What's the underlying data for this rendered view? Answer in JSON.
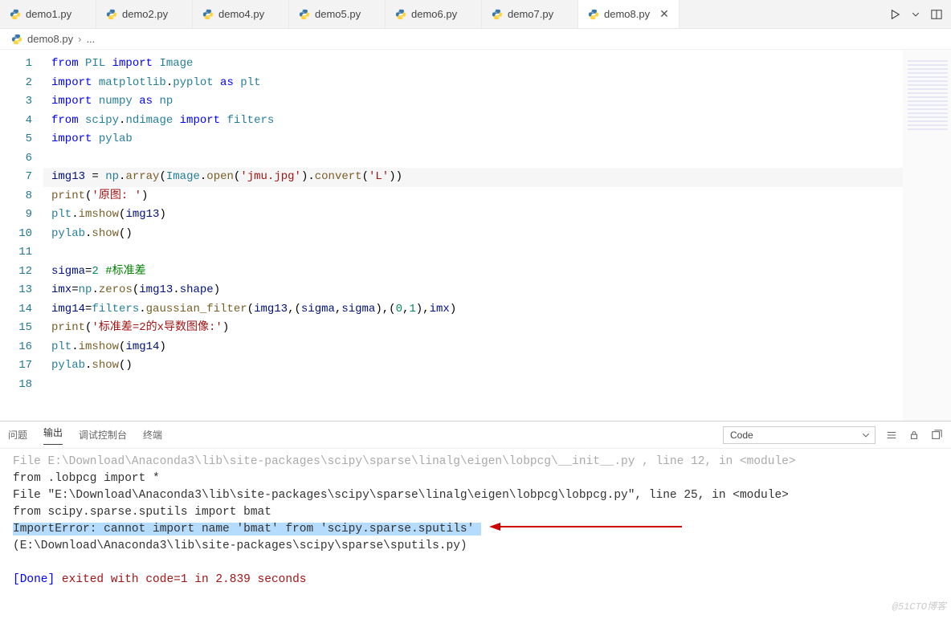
{
  "tabs": [
    {
      "label": "demo1.py"
    },
    {
      "label": "demo2.py"
    },
    {
      "label": "demo4.py"
    },
    {
      "label": "demo5.py"
    },
    {
      "label": "demo6.py"
    },
    {
      "label": "demo7.py"
    },
    {
      "label": "demo8.py",
      "active": true
    }
  ],
  "active_tab_close": "✕",
  "breadcrumb": {
    "file": "demo8.py",
    "sep": "›",
    "rest": "..."
  },
  "code_lines": [
    [
      {
        "t": "from ",
        "c": "kw"
      },
      {
        "t": "PIL ",
        "c": "mod"
      },
      {
        "t": "import ",
        "c": "kw"
      },
      {
        "t": "Image",
        "c": "cls"
      }
    ],
    [
      {
        "t": "import ",
        "c": "kw"
      },
      {
        "t": "matplotlib",
        "c": "mod"
      },
      {
        "t": ".",
        "c": "op"
      },
      {
        "t": "pyplot ",
        "c": "mod"
      },
      {
        "t": "as ",
        "c": "kw"
      },
      {
        "t": "plt",
        "c": "mod"
      }
    ],
    [
      {
        "t": "import ",
        "c": "kw"
      },
      {
        "t": "numpy ",
        "c": "mod"
      },
      {
        "t": "as ",
        "c": "kw"
      },
      {
        "t": "np",
        "c": "mod"
      }
    ],
    [
      {
        "t": "from ",
        "c": "kw"
      },
      {
        "t": "scipy",
        "c": "mod"
      },
      {
        "t": ".",
        "c": "op"
      },
      {
        "t": "ndimage ",
        "c": "mod"
      },
      {
        "t": "import ",
        "c": "kw"
      },
      {
        "t": "filters",
        "c": "mod"
      }
    ],
    [
      {
        "t": "import ",
        "c": "kw"
      },
      {
        "t": "pylab",
        "c": "mod"
      }
    ],
    [],
    [
      {
        "t": "img13 ",
        "c": "var"
      },
      {
        "t": "= ",
        "c": "op"
      },
      {
        "t": "np",
        "c": "mod"
      },
      {
        "t": ".",
        "c": "op"
      },
      {
        "t": "array",
        "c": "fn"
      },
      {
        "t": "(",
        "c": "op"
      },
      {
        "t": "Image",
        "c": "cls"
      },
      {
        "t": ".",
        "c": "op"
      },
      {
        "t": "open",
        "c": "fn"
      },
      {
        "t": "(",
        "c": "op"
      },
      {
        "t": "'jmu.jpg'",
        "c": "str"
      },
      {
        "t": ")",
        "c": "op"
      },
      {
        "t": ".",
        "c": "op"
      },
      {
        "t": "convert",
        "c": "fn"
      },
      {
        "t": "(",
        "c": "op"
      },
      {
        "t": "'L'",
        "c": "str"
      },
      {
        "t": "))",
        "c": "op"
      }
    ],
    [
      {
        "t": "print",
        "c": "fn"
      },
      {
        "t": "(",
        "c": "op"
      },
      {
        "t": "'原图: '",
        "c": "str"
      },
      {
        "t": ")",
        "c": "op"
      }
    ],
    [
      {
        "t": "plt",
        "c": "mod"
      },
      {
        "t": ".",
        "c": "op"
      },
      {
        "t": "imshow",
        "c": "fn"
      },
      {
        "t": "(",
        "c": "op"
      },
      {
        "t": "img13",
        "c": "var"
      },
      {
        "t": ")",
        "c": "op"
      }
    ],
    [
      {
        "t": "pylab",
        "c": "mod"
      },
      {
        "t": ".",
        "c": "op"
      },
      {
        "t": "show",
        "c": "fn"
      },
      {
        "t": "()",
        "c": "op"
      }
    ],
    [],
    [
      {
        "t": "sigma",
        "c": "var"
      },
      {
        "t": "=",
        "c": "op"
      },
      {
        "t": "2 ",
        "c": "num"
      },
      {
        "t": "#标准差",
        "c": "cmt"
      }
    ],
    [
      {
        "t": "imx",
        "c": "var"
      },
      {
        "t": "=",
        "c": "op"
      },
      {
        "t": "np",
        "c": "mod"
      },
      {
        "t": ".",
        "c": "op"
      },
      {
        "t": "zeros",
        "c": "fn"
      },
      {
        "t": "(",
        "c": "op"
      },
      {
        "t": "img13",
        "c": "var"
      },
      {
        "t": ".",
        "c": "op"
      },
      {
        "t": "shape",
        "c": "var"
      },
      {
        "t": ")",
        "c": "op"
      }
    ],
    [
      {
        "t": "img14",
        "c": "var"
      },
      {
        "t": "=",
        "c": "op"
      },
      {
        "t": "filters",
        "c": "mod"
      },
      {
        "t": ".",
        "c": "op"
      },
      {
        "t": "gaussian_filter",
        "c": "fn"
      },
      {
        "t": "(",
        "c": "op"
      },
      {
        "t": "img13",
        "c": "var"
      },
      {
        "t": ",(",
        "c": "op"
      },
      {
        "t": "sigma",
        "c": "var"
      },
      {
        "t": ",",
        "c": "op"
      },
      {
        "t": "sigma",
        "c": "var"
      },
      {
        "t": "),(",
        "c": "op"
      },
      {
        "t": "0",
        "c": "num"
      },
      {
        "t": ",",
        "c": "op"
      },
      {
        "t": "1",
        "c": "num"
      },
      {
        "t": "),",
        "c": "op"
      },
      {
        "t": "imx",
        "c": "var"
      },
      {
        "t": ")",
        "c": "op"
      }
    ],
    [
      {
        "t": "print",
        "c": "fn"
      },
      {
        "t": "(",
        "c": "op"
      },
      {
        "t": "'标准差=2的x导数图像:'",
        "c": "str"
      },
      {
        "t": ")",
        "c": "op"
      }
    ],
    [
      {
        "t": "plt",
        "c": "mod"
      },
      {
        "t": ".",
        "c": "op"
      },
      {
        "t": "imshow",
        "c": "fn"
      },
      {
        "t": "(",
        "c": "op"
      },
      {
        "t": "img14",
        "c": "var"
      },
      {
        "t": ")",
        "c": "op"
      }
    ],
    [
      {
        "t": "pylab",
        "c": "mod"
      },
      {
        "t": ".",
        "c": "op"
      },
      {
        "t": "show",
        "c": "fn"
      },
      {
        "t": "()",
        "c": "op"
      }
    ],
    []
  ],
  "highlight_line_index": 6,
  "panel": {
    "tabs": {
      "problems": "问题",
      "output": "输出",
      "debug_console": "调试控制台",
      "terminal": "终端"
    },
    "select_label": "Code",
    "output": {
      "l0": "  File  E:\\Download\\Anaconda3\\lib\\site-packages\\scipy\\sparse\\linalg\\eigen\\lobpcg\\__init__.py , line 12, in <module>",
      "l1": "    from .lobpcg import *",
      "l2": "  File \"E:\\Download\\Anaconda3\\lib\\site-packages\\scipy\\sparse\\linalg\\eigen\\lobpcg\\lobpcg.py\", line 25, in <module>",
      "l3": "    from scipy.sparse.sputils import bmat",
      "l4": "ImportError: cannot import name 'bmat' from 'scipy.sparse.sputils' ",
      "l5": "(E:\\Download\\Anaconda3\\lib\\site-packages\\scipy\\sparse\\sputils.py)",
      "done_prefix": "[Done] ",
      "done_rest": "exited with code=1 in 2.839 seconds"
    }
  },
  "watermark": "@51CTO博客"
}
